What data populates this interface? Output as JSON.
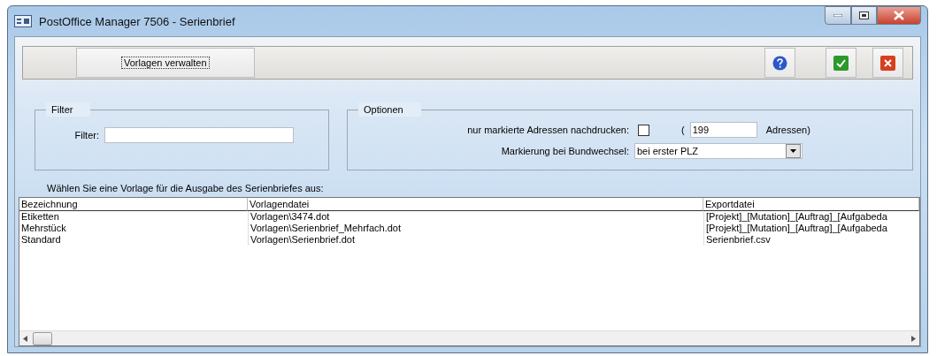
{
  "window": {
    "title": "PostOffice Manager 7506 - Serienbrief"
  },
  "toolbar": {
    "manage_button": "Vorlagen verwalten"
  },
  "filter_group": {
    "title": "Filter",
    "label": "Filter:"
  },
  "options_group": {
    "title": "Optionen",
    "reprint_label": "nur markierte Adressen nachdrucken:",
    "reprint_checked": false,
    "count_open": "(",
    "count_value": "199",
    "count_close": "Adressen)",
    "marking_label": "Markierung bei Bundwechsel:",
    "marking_value": "bei erster PLZ"
  },
  "prompt": "Wählen Sie eine Vorlage für die Ausgabe des Serienbriefes aus:",
  "table": {
    "columns": [
      "Bezeichnung",
      "Vorlagendatei",
      "Exportdatei"
    ],
    "rows": [
      {
        "cells": [
          "Etiketten",
          "Vorlagen\\3474.dot",
          "[Projekt]_[Mutation]_[Auftrag]_[Aufgabeda"
        ]
      },
      {
        "cells": [
          "Mehrstück",
          "Vorlagen\\Serienbrief_Mehrfach.dot",
          "[Projekt]_[Mutation]_[Auftrag]_[Aufgabeda"
        ]
      },
      {
        "cells": [
          "Standard",
          "Vorlagen\\Serienbrief.dot",
          "Serienbrief.csv"
        ]
      }
    ]
  }
}
